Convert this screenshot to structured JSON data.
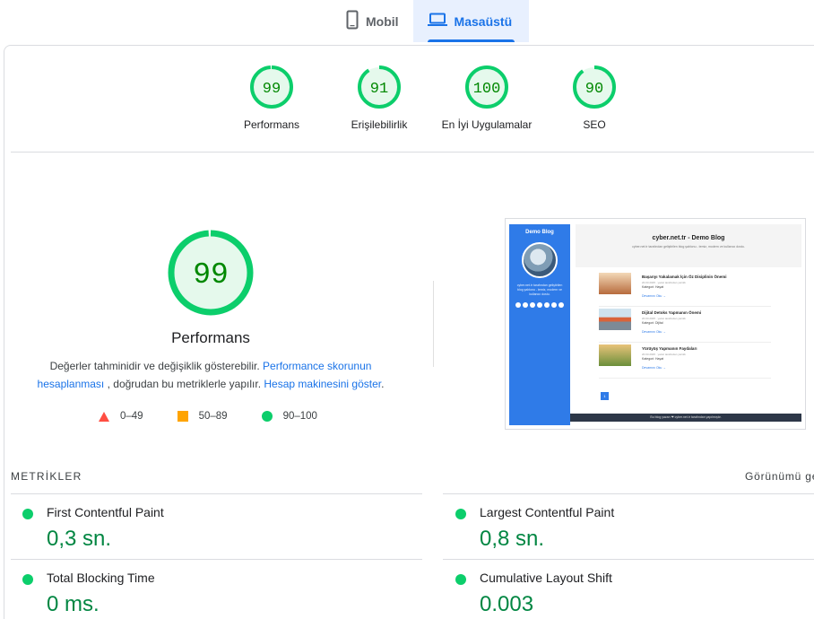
{
  "tabs": [
    {
      "label": "Mobil",
      "icon": "smartphone-icon",
      "active": false
    },
    {
      "label": "Masaüstü",
      "icon": "laptop-icon",
      "active": true
    }
  ],
  "scores": [
    {
      "value": "99",
      "score": 99,
      "label": "Performans"
    },
    {
      "value": "91",
      "score": 91,
      "label": "Erişilebilirlik"
    },
    {
      "value": "100",
      "score": 100,
      "label": "En İyi Uygulamalar"
    },
    {
      "value": "90",
      "score": 90,
      "label": "SEO"
    }
  ],
  "performance": {
    "value": "99",
    "score": 99,
    "title": "Performans",
    "desc_part1": "Değerler tahminidir ve değişiklik gösterebilir.",
    "desc_link1": "Performance skorunun hesaplanması",
    "desc_part2": ", doğrudan bu metriklerle yapılır.",
    "desc_link2": "Hesap makinesini göster",
    "desc_part3": "."
  },
  "legend": [
    {
      "range": "0–49",
      "shape": "triangle",
      "color": "#ff4e42"
    },
    {
      "range": "50–89",
      "shape": "square",
      "color": "#ffa400"
    },
    {
      "range": "90–100",
      "shape": "circle",
      "color": "#0cce6b"
    }
  ],
  "screenshot": {
    "sidebar_title": "Demo Blog",
    "sidebar_desc": "cyber.net.tr tarafından geliştirilen blog şablonu - temiz, modern ve kullanıcı dostu.",
    "header_title": "cyber.net.tr - Demo Blog",
    "header_subtitle": "cyber.net.tr tarafından geliştirilen blog şablonu - temiz, modern ve kullanıcı dostu.",
    "posts": [
      {
        "title": "Başarıyı Yakalamak İçin Öz Disiplinin Önemi",
        "meta": "20.03.2025 · yazar tarafından yazıldı",
        "category": "Kategori: Hayat",
        "more": "Devamını Oku →"
      },
      {
        "title": "Dijital Detoks Yapmanın Önemi",
        "meta": "20.03.2025 · yazar tarafından yazıldı",
        "category": "Kategori: Dijital",
        "more": "Devamını Oku →"
      },
      {
        "title": "Yürüyüş Yapmanın Faydaları",
        "meta": "20.03.2025 · yazar tarafından yazıldı",
        "category": "Kategori: Hayat",
        "more": "Devamını Oku →"
      }
    ],
    "page_button": "1",
    "footer": "Bu blog yazarı ❤ cyber.net.tr tarafından yapılmıştır."
  },
  "metrics_section": {
    "title": "METRİKLER",
    "toggle": "Görünümü ge"
  },
  "metrics": [
    {
      "name": "First Contentful Paint",
      "value": "0,3 sn."
    },
    {
      "name": "Largest Contentful Paint",
      "value": "0,8 sn."
    },
    {
      "name": "Total Blocking Time",
      "value": "0 ms."
    },
    {
      "name": "Cumulative Layout Shift",
      "value": "0.003"
    }
  ],
  "colors": {
    "pass": "#0cce6b",
    "pass_text": "#008800",
    "pass_fill": "#e5f9ec",
    "accent": "#1a73e8"
  }
}
